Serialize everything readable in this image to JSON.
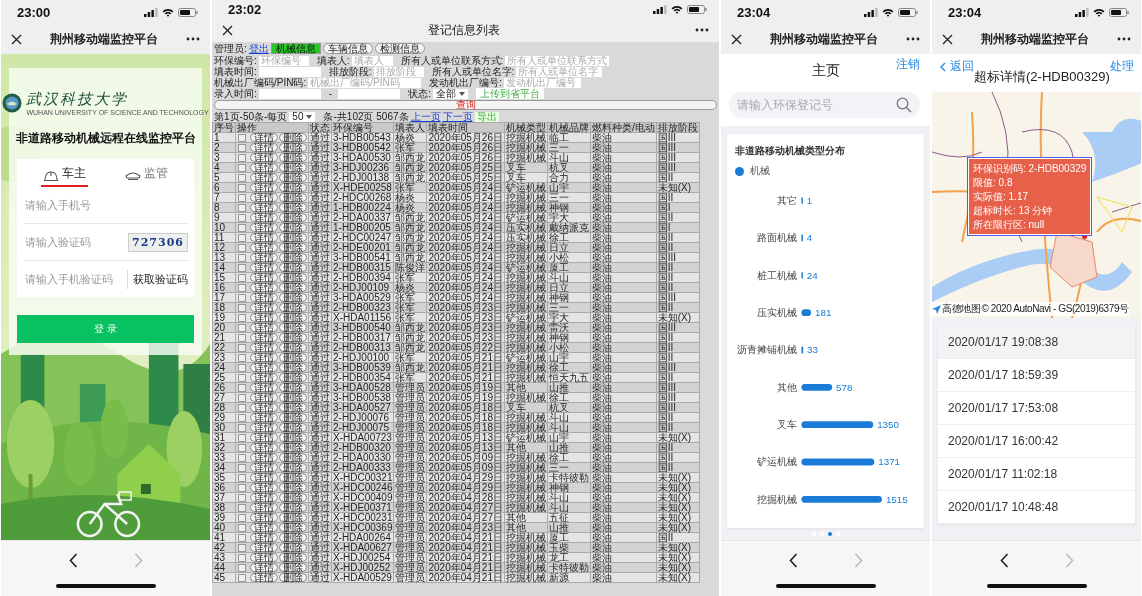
{
  "phones": [
    {
      "kind": "login",
      "status_time": "23:00",
      "title": "荆州移动端监控平台",
      "bottom_nav": {
        "back_enabled": true,
        "forward_enabled": false
      },
      "logo": {
        "name": "武汉科技大学",
        "subtitle": "WUHAN UNIVERSITY OF SCIENCE AND TECHNOLOGY"
      },
      "heading": "非道路移动机械远程在线监控平台",
      "tabs": [
        {
          "label": "车主",
          "selected": true
        },
        {
          "label": "监管",
          "selected": false
        }
      ],
      "fields": [
        {
          "kind": "text",
          "placeholder": "请输入手机号"
        },
        {
          "kind": "captcha",
          "placeholder": "请输入验证码",
          "captcha": "727306"
        },
        {
          "kind": "sms",
          "placeholder": "请输入手机验证码",
          "button": "获取验证码"
        }
      ],
      "login_button": "登 录"
    },
    {
      "kind": "table",
      "status_time": "23:02",
      "title": "登记信息列表",
      "toolbar": {
        "user_label": "管理员:",
        "logout": "登出",
        "tabs": [
          {
            "label": "机械信息",
            "selected": true
          },
          {
            "label": "车辆信息",
            "selected": false
          },
          {
            "label": "检测信息",
            "selected": false
          }
        ]
      },
      "filter_lines": [
        [
          {
            "kind": "field",
            "label": "环保编号:",
            "placeholder": "环保编号"
          },
          {
            "kind": "field",
            "label": "填表人:",
            "placeholder": "填表人"
          },
          {
            "kind": "field",
            "label": "所有人或单位联系方式:",
            "placeholder": "所有人或单位联系方式"
          }
        ],
        [
          {
            "kind": "date",
            "label": "填表时间:"
          },
          {
            "kind": "field",
            "label": "排放阶段:",
            "placeholder": "排放阶段"
          },
          {
            "kind": "field",
            "label": "所有人或单位名字:",
            "placeholder": "所有人或单位名字"
          }
        ],
        [
          {
            "kind": "field",
            "label": "机械出厂编码/PIN码:",
            "placeholder": "机械出厂编码/PIN码"
          },
          {
            "kind": "field",
            "label": "发动机出厂编号:",
            "placeholder": "发动机出厂编号"
          }
        ],
        [
          {
            "kind": "date",
            "label": "录入时间:"
          },
          {
            "kind": "text",
            "text": "-"
          },
          {
            "kind": "date"
          },
          {
            "kind": "select",
            "label": "状态:",
            "value": "全部"
          },
          {
            "kind": "button",
            "label": "上传到省平台"
          }
        ]
      ],
      "query_button": "查询",
      "paging": {
        "prefix": "第1页-50条-每页",
        "page_size": "50",
        "summary": "条-共102页 5067条",
        "prev": "上一页",
        "next": "下一页",
        "export": "导出"
      },
      "columns": [
        "序号",
        "操作",
        "状态",
        "环保编号",
        "填表人",
        "填表时间",
        "机械类型",
        "机械品牌",
        "燃料种类/电动",
        "排放阶段"
      ],
      "rows": [
        {
          "checked": false,
          "cells": [
            "1",
            {
              "buttons": [
                "详情",
                "删除"
              ]
            },
            "通过",
            "3-HDB00543",
            "杨炎",
            "2020年05月26日",
            "挖掘机械",
            "临工",
            "柴油",
            "国III"
          ]
        },
        {
          "checked": false,
          "cells": [
            "2",
            {
              "buttons": [
                "详情",
                "删除"
              ]
            },
            "通过",
            "3-HDB00542",
            "张军",
            "2020年05月26日",
            "挖掘机械",
            "三一",
            "柴油",
            "国III"
          ]
        },
        {
          "checked": false,
          "cells": [
            "3",
            {
              "buttons": [
                "详情",
                "删除"
              ]
            },
            "通过",
            "3-HDA00530",
            "邹西龙",
            "2020年05月26日",
            "挖掘机械",
            "斗山",
            "柴油",
            "国III"
          ]
        },
        {
          "checked": false,
          "cells": [
            "4",
            {
              "buttons": [
                "详情",
                "删除"
              ]
            },
            "通过",
            "3-HDJ00236",
            "邹西龙",
            "2020年05月25日",
            "叉车",
            "杭叉",
            "柴油",
            "国III"
          ]
        },
        {
          "checked": false,
          "cells": [
            "5",
            {
              "buttons": [
                "详情",
                "删除"
              ]
            },
            "通过",
            "2-HDJ00138",
            "邹西龙",
            "2020年05月25日",
            "叉车",
            "合力",
            "柴油",
            "国II"
          ]
        },
        {
          "checked": false,
          "cells": [
            "6",
            {
              "buttons": [
                "详情",
                "删除"
              ]
            },
            "通过",
            "X-HDE00258",
            "张军",
            "2020年05月24日",
            "铲运机械",
            "山宇",
            "柴油",
            "未知(X)"
          ]
        },
        {
          "checked": false,
          "cells": [
            "7",
            {
              "buttons": [
                "详情",
                "删除"
              ]
            },
            "通过",
            "2-HDC00268",
            "杨炎",
            "2020年05月24日",
            "挖掘机械",
            "三一",
            "柴油",
            "国II"
          ]
        },
        {
          "checked": false,
          "cells": [
            "8",
            {
              "buttons": [
                "详情",
                "删除"
              ]
            },
            "通过",
            "1-HDB00224",
            "杨炎",
            "2020年05月24日",
            "挖掘机械",
            "神钢",
            "柴油",
            "国I"
          ]
        },
        {
          "checked": false,
          "cells": [
            "9",
            {
              "buttons": [
                "详情",
                "删除"
              ]
            },
            "通过",
            "2-HDA00337",
            "邹西龙",
            "2020年05月24日",
            "铲运机械",
            "宇大",
            "柴油",
            "国II"
          ]
        },
        {
          "checked": false,
          "cells": [
            "10",
            {
              "buttons": [
                "详情",
                "删除"
              ]
            },
            "通过",
            "1-HDB00205",
            "邹西龙",
            "2020年05月24日",
            "压实机械",
            "戴纳派克",
            "柴油",
            "国I"
          ]
        },
        {
          "checked": false,
          "cells": [
            "11",
            {
              "buttons": [
                "详情",
                "删除"
              ]
            },
            "通过",
            "2-HDC00247",
            "邹西龙",
            "2020年05月24日",
            "压实机械",
            "徐工",
            "柴油",
            "国II"
          ]
        },
        {
          "checked": false,
          "cells": [
            "12",
            {
              "buttons": [
                "详情",
                "删除"
              ]
            },
            "通过",
            "2-HDE00201",
            "邹西龙",
            "2020年05月24日",
            "挖掘机械",
            "日立",
            "柴油",
            "国II"
          ]
        },
        {
          "checked": false,
          "cells": [
            "13",
            {
              "buttons": [
                "详情",
                "删除"
              ]
            },
            "通过",
            "3-HDB00541",
            "邹西龙",
            "2020年05月24日",
            "挖掘机械",
            "小松",
            "柴油",
            "国III"
          ]
        },
        {
          "checked": false,
          "cells": [
            "14",
            {
              "buttons": [
                "详情",
                "删除"
              ]
            },
            "通过",
            "2-HDB00315",
            "陈俊洋",
            "2020年05月24日",
            "铲运机械",
            "厦工",
            "柴油",
            "国II"
          ]
        },
        {
          "checked": false,
          "cells": [
            "15",
            {
              "buttons": [
                "详情",
                "删除"
              ]
            },
            "通过",
            "2-HDB00394",
            "张军",
            "2020年05月24日",
            "挖掘机械",
            "斗山",
            "柴油",
            "国II"
          ]
        },
        {
          "checked": false,
          "cells": [
            "16",
            {
              "buttons": [
                "详情",
                "删除"
              ]
            },
            "通过",
            "2-HDJ00109",
            "杨炎",
            "2020年05月24日",
            "挖掘机械",
            "日立",
            "柴油",
            "国II"
          ]
        },
        {
          "checked": false,
          "cells": [
            "17",
            {
              "buttons": [
                "详情",
                "删除"
              ]
            },
            "通过",
            "3-HDA00529",
            "张军",
            "2020年05月24日",
            "挖掘机械",
            "神钢",
            "柴油",
            "国III"
          ]
        },
        {
          "checked": false,
          "cells": [
            "18",
            {
              "buttons": [
                "详情",
                "删除"
              ]
            },
            "通过",
            "2-HDB00323",
            "张军",
            "2020年05月23日",
            "挖掘机械",
            "三一",
            "柴油",
            "国II"
          ]
        },
        {
          "checked": false,
          "cells": [
            "19",
            {
              "buttons": [
                "详情",
                "删除"
              ]
            },
            "通过",
            "X-HDA01156",
            "张军",
            "2020年05月23日",
            "铲运机械",
            "宇大",
            "柴油",
            "未知(X)"
          ]
        },
        {
          "checked": false,
          "cells": [
            "20",
            {
              "buttons": [
                "详情",
                "删除"
              ]
            },
            "通过",
            "3-HDB00540",
            "邹西龙",
            "2020年05月23日",
            "挖掘机械",
            "雷沃",
            "柴油",
            "国III"
          ]
        },
        {
          "checked": false,
          "cells": [
            "21",
            {
              "buttons": [
                "详情",
                "删除"
              ]
            },
            "通过",
            "2-HDB00317",
            "邹西龙",
            "2020年05月23日",
            "挖掘机械",
            "神钢",
            "柴油",
            "国II"
          ]
        },
        {
          "checked": false,
          "cells": [
            "22",
            {
              "buttons": [
                "详情",
                "删除"
              ]
            },
            "通过",
            "2-HDB00313",
            "邹西龙",
            "2020年05月22日",
            "挖掘机械",
            "小松",
            "柴油",
            "国II"
          ]
        },
        {
          "checked": false,
          "cells": [
            "23",
            {
              "buttons": [
                "详情",
                "删除"
              ]
            },
            "通过",
            "2-HDJ00100",
            "张军",
            "2020年05月21日",
            "铲运机械",
            "山宇",
            "柴油",
            "国II"
          ]
        },
        {
          "checked": false,
          "cells": [
            "24",
            {
              "buttons": [
                "详情",
                "删除"
              ]
            },
            "通过",
            "3-HDB00539",
            "邹西龙",
            "2020年05月21日",
            "挖掘机械",
            "徐工",
            "柴油",
            "国III"
          ]
        },
        {
          "checked": false,
          "cells": [
            "25",
            {
              "buttons": [
                "详情",
                "删除"
              ]
            },
            "通过",
            "2-HDB00354",
            "张军",
            "2020年05月21日",
            "挖掘机械",
            "恒天九五",
            "柴油",
            "国II"
          ]
        },
        {
          "checked": false,
          "cells": [
            "26",
            {
              "buttons": [
                "详情",
                "删除"
              ]
            },
            "通过",
            "3-HDA00528",
            "管理员",
            "2020年05月19日",
            "其他",
            "山推",
            "柴油",
            "国III"
          ]
        },
        {
          "checked": false,
          "cells": [
            "27",
            {
              "buttons": [
                "详情",
                "删除"
              ]
            },
            "通过",
            "3-HDB00538",
            "管理员",
            "2020年05月19日",
            "挖掘机械",
            "徐工",
            "柴油",
            "国III"
          ]
        },
        {
          "checked": false,
          "cells": [
            "28",
            {
              "buttons": [
                "详情",
                "删除"
              ]
            },
            "通过",
            "3-HDA00527",
            "管理员",
            "2020年05月18日",
            "叉车",
            "杭叉",
            "柴油",
            "国III"
          ]
        },
        {
          "checked": false,
          "cells": [
            "29",
            {
              "buttons": [
                "详情",
                "删除"
              ]
            },
            "通过",
            "2-HDJ00076",
            "管理员",
            "2020年05月18日",
            "挖掘机械",
            "斗山",
            "柴油",
            "国II"
          ]
        },
        {
          "checked": false,
          "cells": [
            "30",
            {
              "buttons": [
                "详情",
                "删除"
              ]
            },
            "通过",
            "2-HDJ00075",
            "管理员",
            "2020年05月18日",
            "挖掘机械",
            "斗山",
            "柴油",
            "国II"
          ]
        },
        {
          "checked": false,
          "cells": [
            "31",
            {
              "buttons": [
                "详情",
                "删除"
              ]
            },
            "通过",
            "X-HDA00723",
            "管理员",
            "2020年05月13日",
            "铲运机械",
            "山宇",
            "柴油",
            "未知(X)"
          ]
        },
        {
          "checked": false,
          "cells": [
            "32",
            {
              "buttons": [
                "详情",
                "删除"
              ]
            },
            "通过",
            "2-HDB00320",
            "管理员",
            "2020年05月13日",
            "其他",
            "山推",
            "柴油",
            "国II"
          ]
        },
        {
          "checked": false,
          "cells": [
            "33",
            {
              "buttons": [
                "详情",
                "删除"
              ]
            },
            "通过",
            "2-HDA00330",
            "管理员",
            "2020年05月09日",
            "挖掘机械",
            "徐工",
            "柴油",
            "国II"
          ]
        },
        {
          "checked": false,
          "cells": [
            "34",
            {
              "buttons": [
                "详情",
                "删除"
              ]
            },
            "通过",
            "2-HDA00333",
            "管理员",
            "2020年05月09日",
            "挖掘机械",
            "三一",
            "柴油",
            "国II"
          ]
        },
        {
          "checked": false,
          "cells": [
            "35",
            {
              "buttons": [
                "详情",
                "删除"
              ]
            },
            "通过",
            "X-HDC00321",
            "管理员",
            "2020年04月29日",
            "挖掘机械",
            "卡特彼勒",
            "柴油",
            "未知(X)"
          ]
        },
        {
          "checked": false,
          "cells": [
            "36",
            {
              "buttons": [
                "详情",
                "删除"
              ]
            },
            "通过",
            "X-HDC00246",
            "管理员",
            "2020年04月29日",
            "挖掘机械",
            "神钢",
            "柴油",
            "未知(X)"
          ]
        },
        {
          "checked": false,
          "cells": [
            "37",
            {
              "buttons": [
                "详情",
                "删除"
              ]
            },
            "通过",
            "X-HDC00409",
            "管理员",
            "2020年04月28日",
            "挖掘机械",
            "斗山",
            "柴油",
            "未知(X)"
          ]
        },
        {
          "checked": false,
          "cells": [
            "38",
            {
              "buttons": [
                "详情",
                "删除"
              ]
            },
            "通过",
            "X-HDE00371",
            "管理员",
            "2020年04月27日",
            "挖掘机械",
            "斗山",
            "柴油",
            "未知(X)"
          ]
        },
        {
          "checked": false,
          "cells": [
            "39",
            {
              "buttons": [
                "详情",
                "删除"
              ]
            },
            "通过",
            "X-HDC00231",
            "管理员",
            "2020年04月27日",
            "其他",
            "五征",
            "柴油",
            "未知(X)"
          ]
        },
        {
          "checked": false,
          "cells": [
            "40",
            {
              "buttons": [
                "详情",
                "删除"
              ]
            },
            "通过",
            "X-HDC00369",
            "管理员",
            "2020年04月23日",
            "其他",
            "山推",
            "柴油",
            "未知(X)"
          ]
        },
        {
          "checked": false,
          "cells": [
            "41",
            {
              "buttons": [
                "详情",
                "删除"
              ]
            },
            "通过",
            "2-HDA00264",
            "管理员",
            "2020年04月21日",
            "挖掘机械",
            "厦工",
            "柴油",
            "国II"
          ]
        },
        {
          "checked": false,
          "cells": [
            "42",
            {
              "buttons": [
                "详情",
                "删除"
              ]
            },
            "通过",
            "X-HDA00627",
            "管理员",
            "2020年04月21日",
            "挖掘机械",
            "玉柴",
            "柴油",
            "未知(X)"
          ]
        },
        {
          "checked": false,
          "cells": [
            "43",
            {
              "buttons": [
                "详情",
                "删除"
              ]
            },
            "通过",
            "X-HDJ00254",
            "管理员",
            "2020年04月21日",
            "挖掘机械",
            "龙工",
            "柴油",
            "未知(X)"
          ]
        },
        {
          "checked": false,
          "cells": [
            "44",
            {
              "buttons": [
                "详情",
                "删除"
              ]
            },
            "通过",
            "X-HDJ00252",
            "管理员",
            "2020年04月21日",
            "挖掘机械",
            "卡特彼勒",
            "柴油",
            "未知(X)"
          ]
        },
        {
          "checked": false,
          "cells": [
            "45",
            {
              "buttons": [
                "详情",
                "删除"
              ]
            },
            "通过",
            "X-HDA00529",
            "管理员",
            "2020年04月21日",
            "挖掘机械",
            "新源",
            "柴油",
            "未知(X)"
          ]
        }
      ]
    },
    {
      "kind": "chart",
      "status_time": "23:04",
      "title": "荆州移动端监控平台",
      "bottom_nav": {
        "back_enabled": true,
        "forward_enabled": false
      },
      "page_title": "主页",
      "logout": "注销",
      "search": {
        "placeholder": "请输入环保登记号"
      },
      "chart": {
        "chart_data": {
          "type": "bar",
          "orientation": "horizontal",
          "title": "非道路移动机械类型分布",
          "categories": [
            "其它",
            "路面机械",
            "桩工机械",
            "压实机械",
            "沥青摊铺机械",
            "其他",
            "叉车",
            "铲运机械",
            "挖掘机械"
          ],
          "series": [
            {
              "name": "机械",
              "color": "#1a7bd8",
              "values": [
                1,
                4,
                24,
                181,
                33,
                578,
                1350,
                1371,
                1515
              ]
            }
          ],
          "data_labels": true
        }
      },
      "pager": [
        {
          "selected": false
        },
        {
          "selected": false
        },
        {
          "selected": true
        },
        {
          "selected": false
        }
      ]
    },
    {
      "kind": "detail",
      "status_time": "23:04",
      "title": "荆州移动端监控平台",
      "bottom_nav": {
        "back_enabled": true,
        "forward_enabled": false
      },
      "back": "返回",
      "page_title": "超标详情(2-HDB00329)",
      "action": "处理",
      "popup": [
        "环保识别码: 2-HDB00329",
        "限值: 0.8",
        "实际值: 1.17",
        "超标时长: 13 分钟",
        "所在限行区: null"
      ],
      "map_logo": "高德地图",
      "attribution": "© 2020 AutoNavi - GS(2019)6379号",
      "times": [
        {
          "time": "2020/01/17 19:08:38",
          "selected": true
        },
        {
          "time": "2020/01/17 18:59:39",
          "selected": false
        },
        {
          "time": "2020/01/17 17:53:08",
          "selected": false
        },
        {
          "time": "2020/01/17 16:00:42",
          "selected": false
        },
        {
          "time": "2020/01/17 11:02:18",
          "selected": false
        },
        {
          "time": "2020/01/17 10:48:48",
          "selected": false
        }
      ]
    }
  ]
}
